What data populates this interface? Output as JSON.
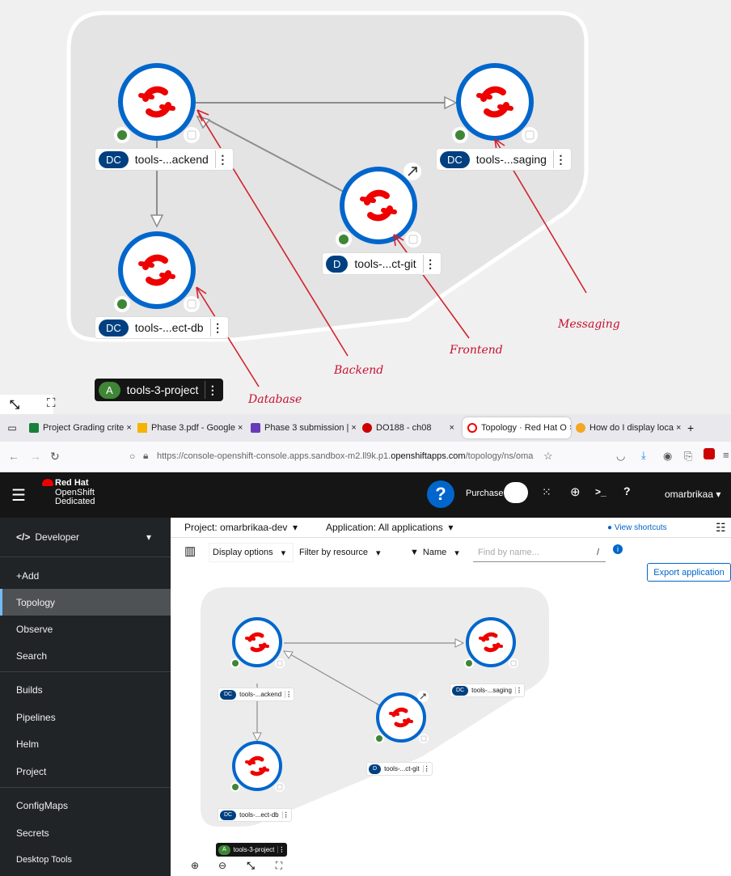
{
  "zoomed": {
    "nodes": [
      {
        "kind": "DC",
        "name": "tools-...ackend"
      },
      {
        "kind": "DC",
        "name": "tools-...saging"
      },
      {
        "kind": "D",
        "name": "tools-...ct-git"
      },
      {
        "kind": "DC",
        "name": "tools-...ect-db"
      }
    ],
    "app_group": {
      "kind": "A",
      "name": "tools-3-project"
    },
    "annotations": {
      "messaging": "Messaging",
      "frontend": "Frontend",
      "backend": "Backend",
      "database": "Database"
    },
    "controls": {
      "fit": "⤡",
      "reset": "⛶"
    }
  },
  "browser": {
    "tabs": [
      {
        "label": "Project Grading crite ×",
        "color": "#188038"
      },
      {
        "label": "Phase 3.pdf - Google ×",
        "color": "#f4b400"
      },
      {
        "label": "Phase 3 submission | ×",
        "color": "#673ab7"
      },
      {
        "label": "DO188 - ch08",
        "color": "#cc0000"
      },
      {
        "label": "Topology · Red Hat O ×",
        "color": "#e00"
      },
      {
        "label": "How do I display loca ×",
        "color": "#f5a623"
      }
    ],
    "tab_close_sep": "×",
    "new_tab": "+",
    "url_prefix": "https://console-openshift-console.apps.sandbox-m2.ll9k.p1.",
    "url_domain": "openshiftapps.com",
    "url_suffix": "/topology/ns/oma"
  },
  "masthead": {
    "brand_line1": "Red Hat",
    "brand_line2": "OpenShift",
    "brand_line3": "Dedicated",
    "purchase": "Purchase",
    "user": "omarbrikaa"
  },
  "sidebar": {
    "perspective": "Developer",
    "items": [
      "+Add",
      "Topology",
      "Observe",
      "Search",
      "Builds",
      "Pipelines",
      "Helm",
      "Project",
      "ConfigMaps",
      "Secrets",
      "Desktop Tools"
    ]
  },
  "toolbar": {
    "project": "Project: omarbrikaa-dev",
    "application": "Application: All applications",
    "view_shortcuts": "View shortcuts",
    "display_options": "Display options",
    "filter_by_resource": "Filter by resource",
    "name_filter": "Name",
    "find_placeholder": "Find by name...",
    "slash": "/",
    "export": "Export application"
  },
  "topology": {
    "nodes": [
      {
        "kind": "DC",
        "name": "tools-...ackend"
      },
      {
        "kind": "DC",
        "name": "tools-...saging"
      },
      {
        "kind": "D",
        "name": "tools-...ct-git"
      },
      {
        "kind": "DC",
        "name": "tools-...ect-db"
      }
    ],
    "app_group": {
      "kind": "A",
      "name": "tools-3-project"
    }
  },
  "colors": {
    "accent": "#0066cc",
    "node_ring": "#0066cc",
    "openshift_red": "#e00",
    "success": "#3e8635",
    "annotation": "#c8102e"
  }
}
